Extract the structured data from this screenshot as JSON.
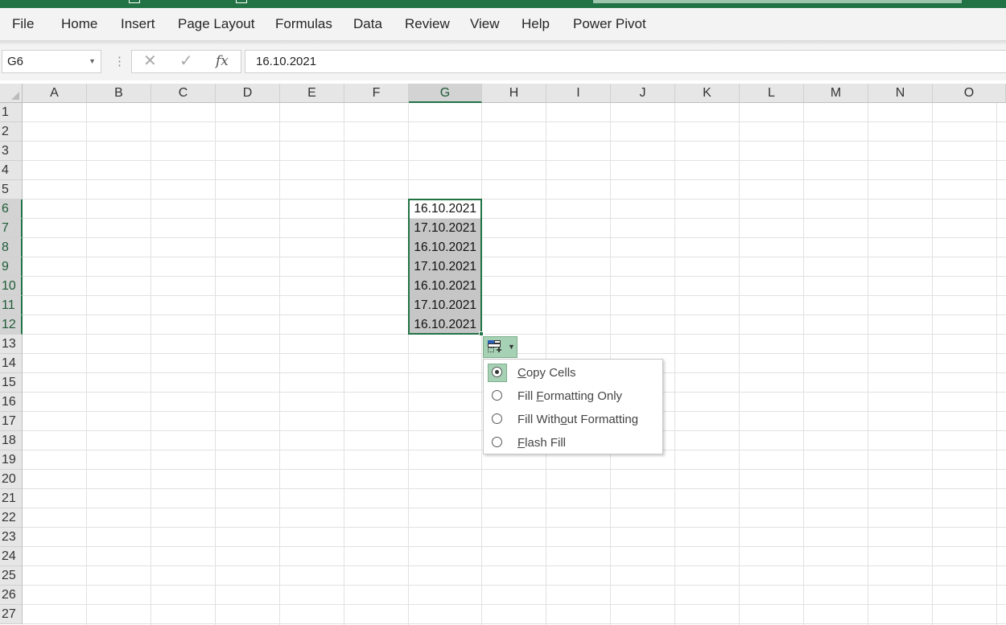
{
  "menu": {
    "items": [
      "File",
      "Home",
      "Insert",
      "Page Layout",
      "Formulas",
      "Data",
      "Review",
      "View",
      "Help",
      "Power Pivot"
    ]
  },
  "formula_bar": {
    "name_box": "G6",
    "cancel_icon": "✕",
    "enter_icon": "✓",
    "fx_label": "fx",
    "value": "16.10.2021"
  },
  "columns": [
    "A",
    "B",
    "C",
    "D",
    "E",
    "F",
    "G",
    "H",
    "I",
    "J",
    "K",
    "L",
    "M",
    "N",
    "O"
  ],
  "selected_column": "G",
  "rows": [
    "1",
    "2",
    "3",
    "4",
    "5",
    "6",
    "7",
    "8",
    "9",
    "10",
    "11",
    "12",
    "13",
    "14",
    "15",
    "16",
    "17",
    "18",
    "19",
    "20",
    "21",
    "22",
    "23",
    "24",
    "25",
    "26",
    "27"
  ],
  "selected_rows": [
    "6",
    "7",
    "8",
    "9",
    "10",
    "11",
    "12"
  ],
  "cells": {
    "G6": "16.10.2021",
    "G7": "17.10.2021",
    "G8": "16.10.2021",
    "G9": "17.10.2021",
    "G10": "16.10.2021",
    "G11": "17.10.2021",
    "G12": "16.10.2021"
  },
  "autofill_menu": {
    "button_icon": "auto-fill-options-icon",
    "options": [
      {
        "pre": "",
        "key": "C",
        "post": "opy Cells",
        "selected": true
      },
      {
        "pre": "Fill ",
        "key": "F",
        "post": "ormatting Only",
        "selected": false
      },
      {
        "pre": "Fill With",
        "key": "o",
        "post": "ut Formatting",
        "selected": false
      },
      {
        "pre": "",
        "key": "F",
        "post": "lash Fill",
        "selected": false
      }
    ]
  },
  "colors": {
    "excel_green": "#217346",
    "selection_shade": "#c6c6c6",
    "accent_light": "#a6d1b4"
  }
}
